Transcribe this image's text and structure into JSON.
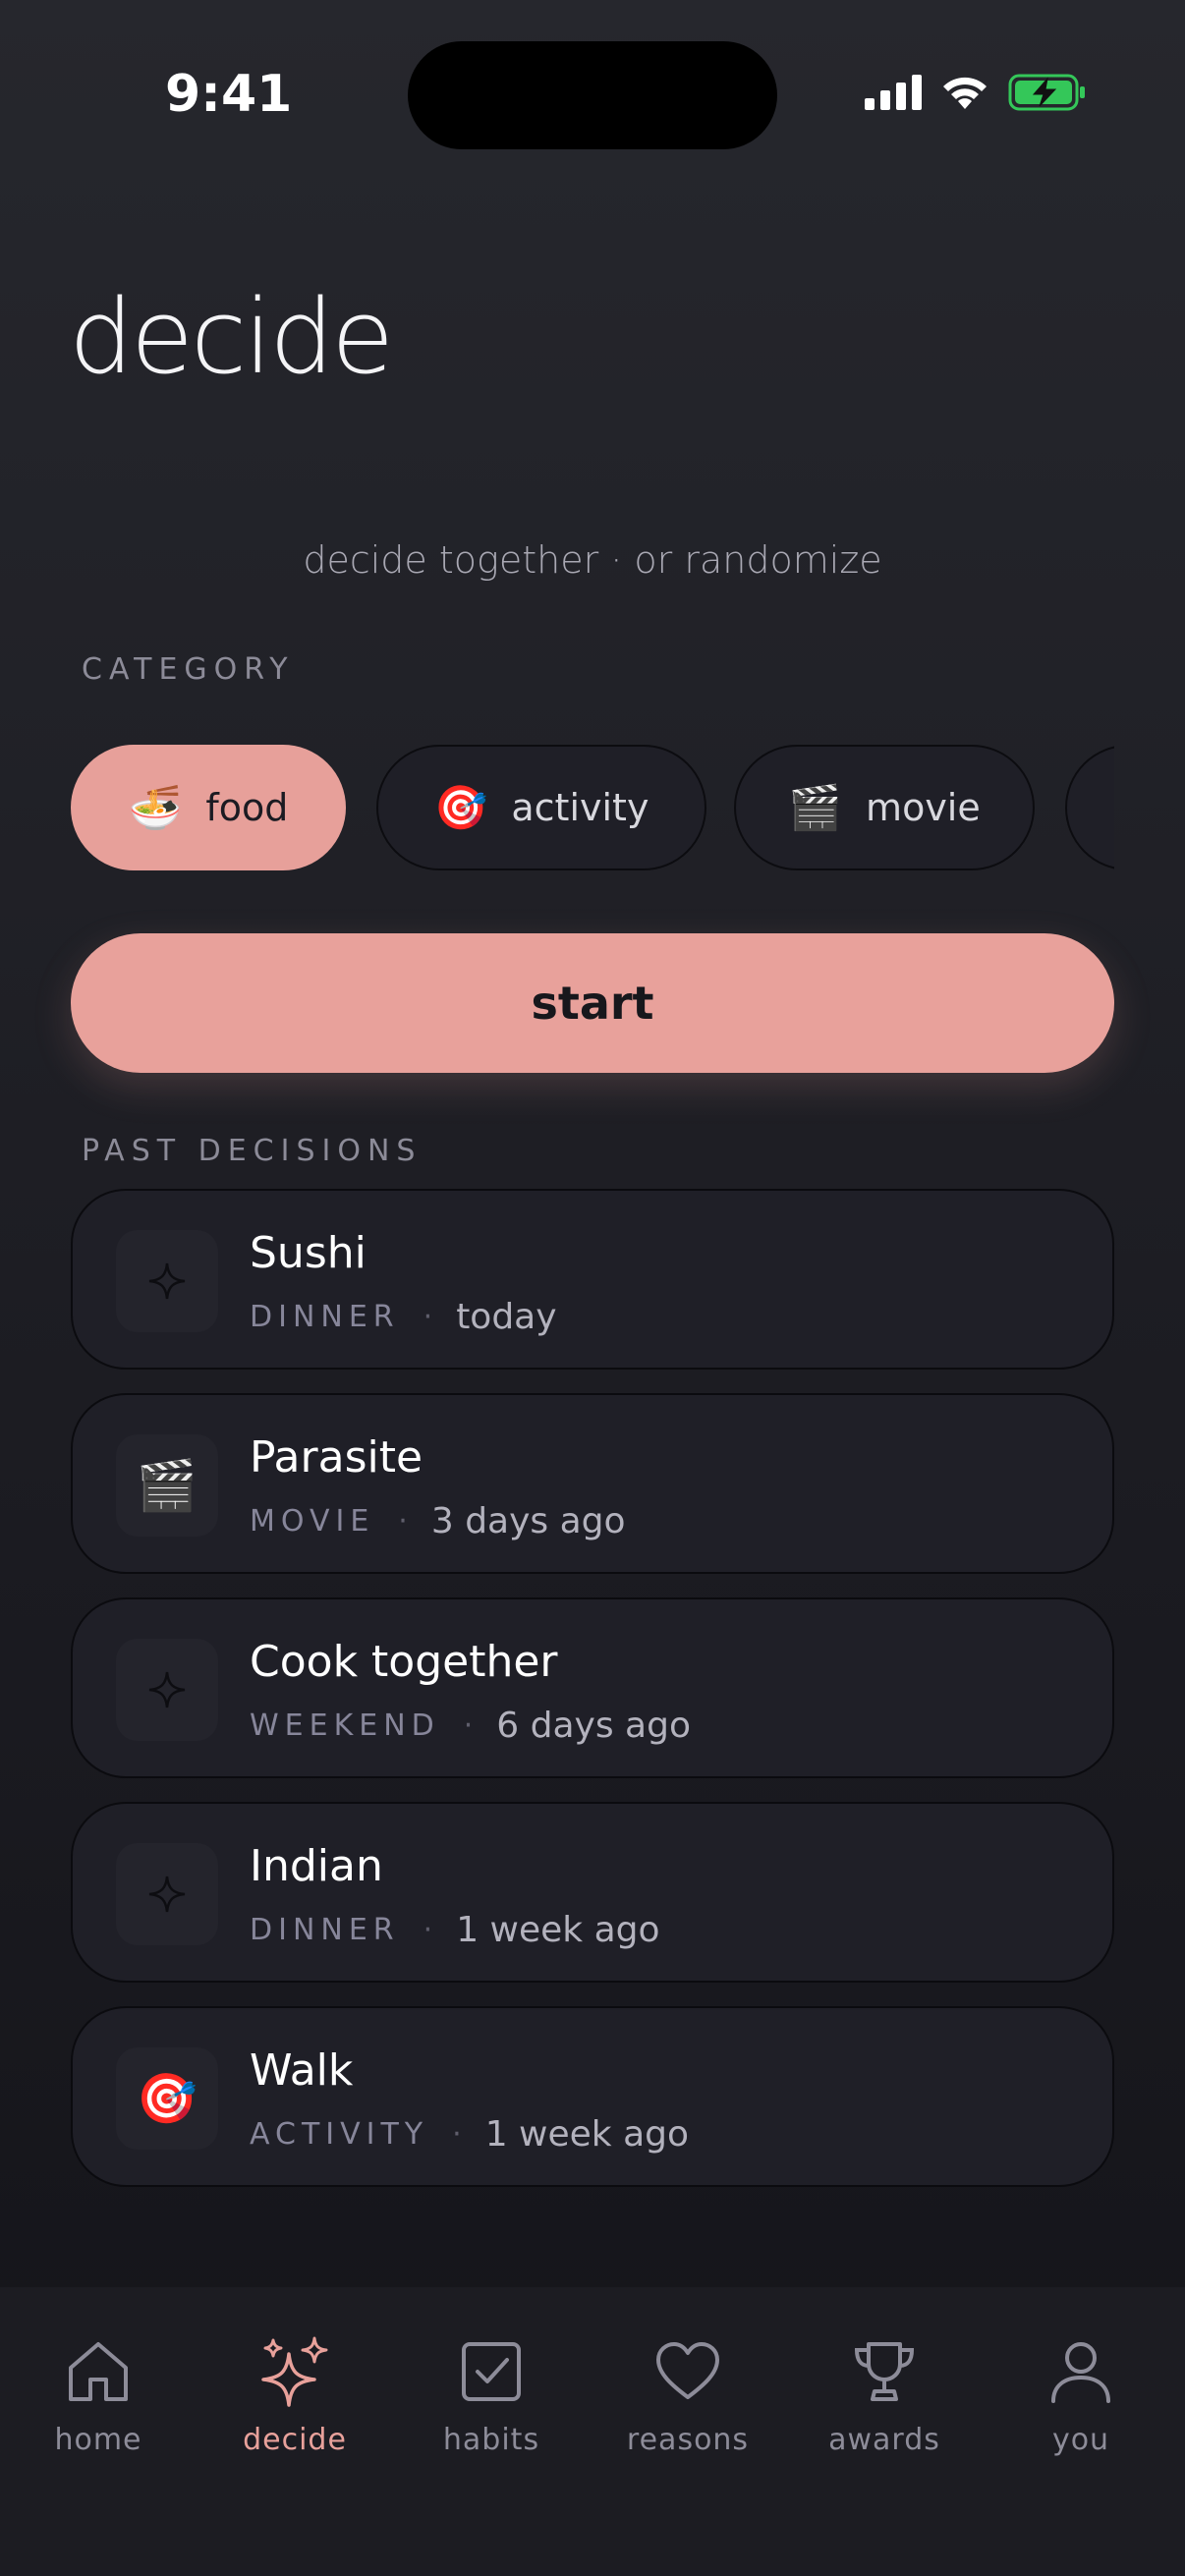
{
  "status": {
    "time": "9:41"
  },
  "header": {
    "title": "decide",
    "subtitle": "decide together · or randomize"
  },
  "category_section": {
    "label": "CATEGORY",
    "chips": [
      {
        "emoji": "🍜",
        "label": "food",
        "selected": true
      },
      {
        "emoji": "🎯",
        "label": "activity",
        "selected": false
      },
      {
        "emoji": "🎬",
        "label": "movie",
        "selected": false
      }
    ]
  },
  "start_label": "start",
  "past_section": {
    "label": "PAST DECISIONS",
    "items": [
      {
        "icon": "sparkle-icon",
        "emoji": "",
        "title": "Sushi",
        "category": "DINNER",
        "when": "today"
      },
      {
        "icon": "clapperboard-icon",
        "emoji": "🎬",
        "title": "Parasite",
        "category": "MOVIE",
        "when": "3 days ago"
      },
      {
        "icon": "sparkle-icon",
        "emoji": "",
        "title": "Cook together",
        "category": "WEEKEND",
        "when": "6 days ago"
      },
      {
        "icon": "sparkle-icon",
        "emoji": "",
        "title": "Indian",
        "category": "DINNER",
        "when": "1 week ago"
      },
      {
        "icon": "dart-icon",
        "emoji": "🎯",
        "title": "Walk",
        "category": "ACTIVITY",
        "when": "1 week ago"
      }
    ]
  },
  "meta_separator": "·",
  "tabbar": {
    "items": [
      {
        "label": "home",
        "icon": "house-icon",
        "active": false
      },
      {
        "label": "decide",
        "icon": "sparkles-icon",
        "active": true
      },
      {
        "label": "habits",
        "icon": "checkbox-icon",
        "active": false
      },
      {
        "label": "reasons",
        "icon": "heart-icon",
        "active": false
      },
      {
        "label": "awards",
        "icon": "trophy-icon",
        "active": false
      },
      {
        "label": "you",
        "icon": "person-icon",
        "active": false
      }
    ]
  },
  "colors": {
    "accent": "#e8a19b",
    "background": "#1b1b21",
    "card": "#1f1f27",
    "battery": "#34c759"
  }
}
